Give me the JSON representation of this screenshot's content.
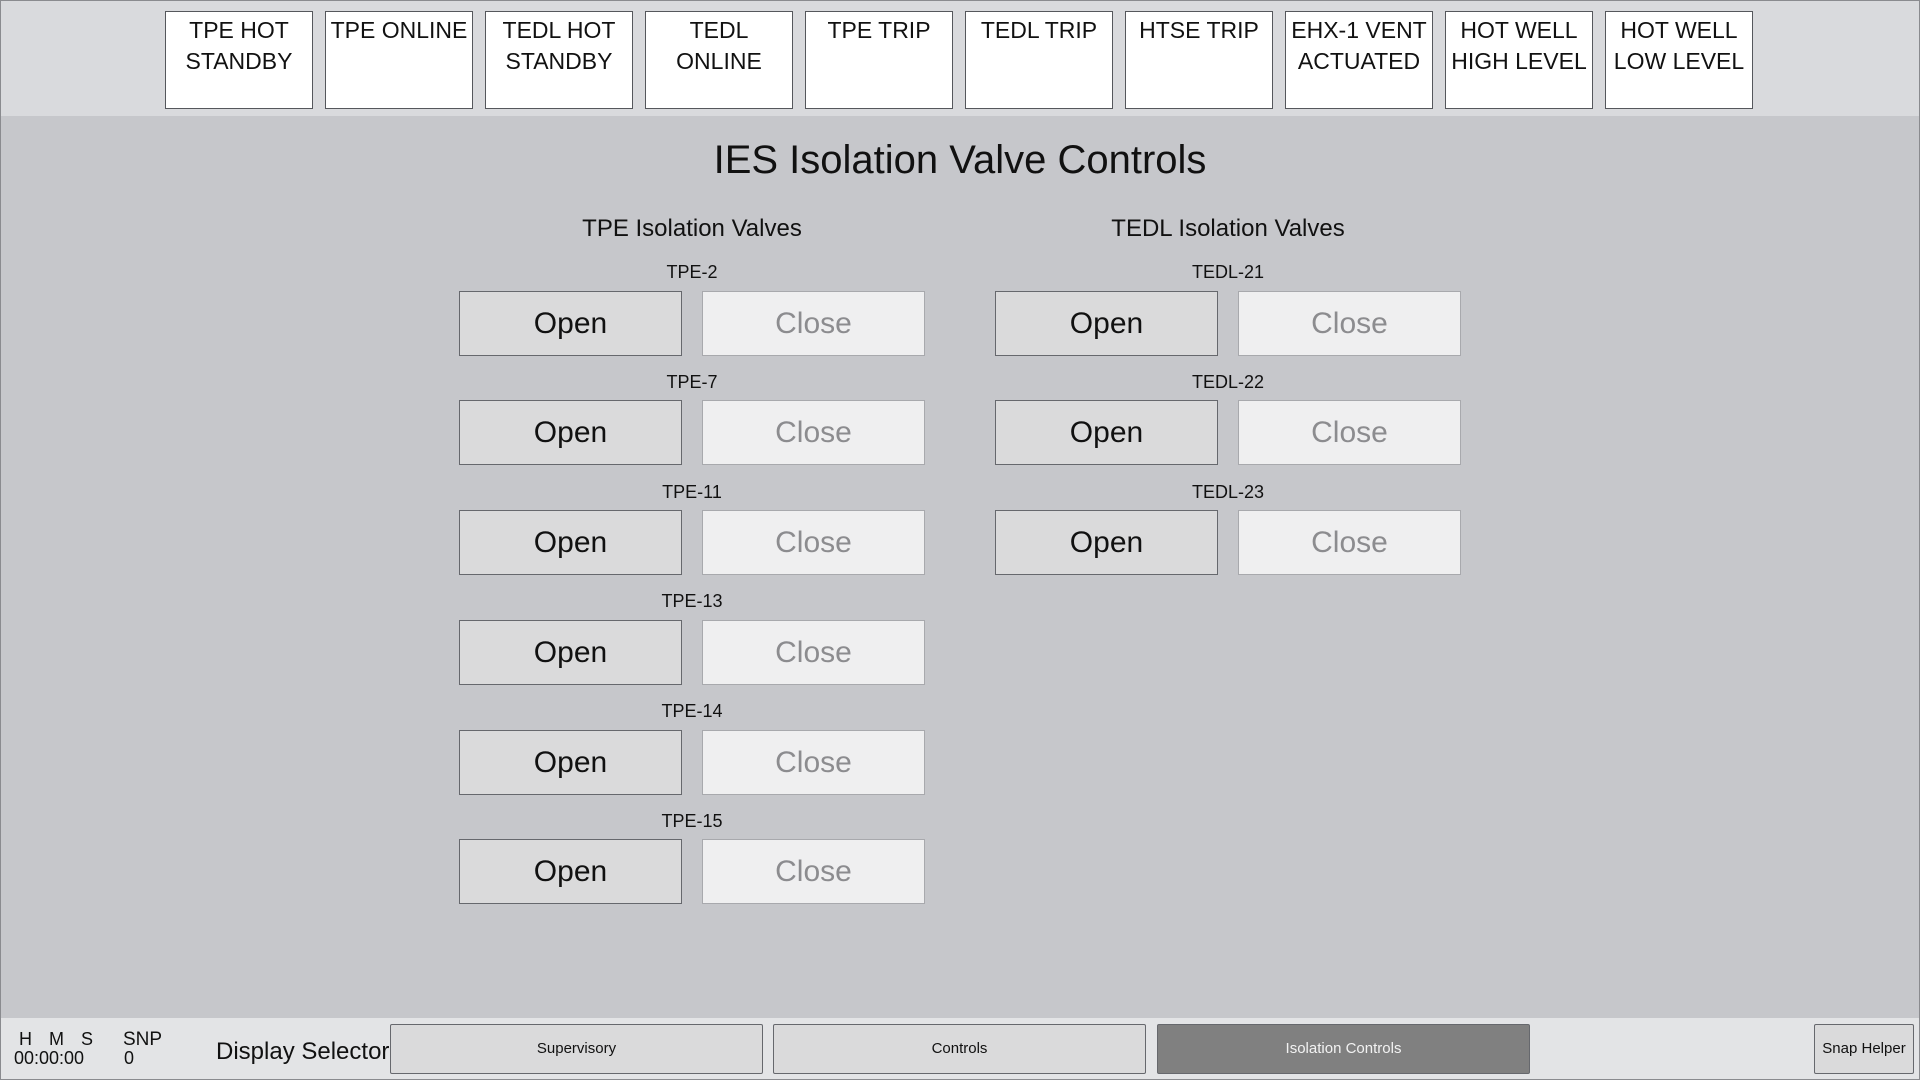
{
  "annunciators": [
    "TPE HOT\nSTANDBY",
    "TPE ONLINE",
    "TEDL HOT\nSTANDBY",
    "TEDL ONLINE",
    "TPE TRIP",
    "TEDL TRIP",
    "HTSE TRIP",
    "EHX-1 VENT\nACTUATED",
    "HOT WELL\nHIGH LEVEL",
    "HOT WELL\nLOW LEVEL"
  ],
  "page_title": "IES Isolation Valve Controls",
  "tpe": {
    "title": "TPE Isolation Valves",
    "valves": [
      {
        "name": "TPE-2",
        "open_label": "Open",
        "close_label": "Close"
      },
      {
        "name": "TPE-7",
        "open_label": "Open",
        "close_label": "Close"
      },
      {
        "name": "TPE-11",
        "open_label": "Open",
        "close_label": "Close"
      },
      {
        "name": "TPE-13",
        "open_label": "Open",
        "close_label": "Close"
      },
      {
        "name": "TPE-14",
        "open_label": "Open",
        "close_label": "Close"
      },
      {
        "name": "TPE-15",
        "open_label": "Open",
        "close_label": "Close"
      }
    ]
  },
  "tedl": {
    "title": "TEDL Isolation Valves",
    "valves": [
      {
        "name": "TEDL-21",
        "open_label": "Open",
        "close_label": "Close"
      },
      {
        "name": "TEDL-22",
        "open_label": "Open",
        "close_label": "Close"
      },
      {
        "name": "TEDL-23",
        "open_label": "Open",
        "close_label": "Close"
      }
    ]
  },
  "status": {
    "time_header": "H M S",
    "time_value": "00:00:00",
    "snp_header": "SNP",
    "snp_value": "0"
  },
  "display_selector": {
    "label": "Display Selector",
    "buttons": [
      "Supervisory",
      "Controls",
      "Isolation Controls"
    ],
    "active": "Isolation Controls"
  },
  "snap_helper_label": "Snap Helper",
  "colors": {
    "background": "#c6c7cb",
    "annunciator_fill": "#ffffff",
    "open_button": "#dadadb",
    "close_button_disabled": "#efeff0",
    "active_nav": "#808080"
  }
}
